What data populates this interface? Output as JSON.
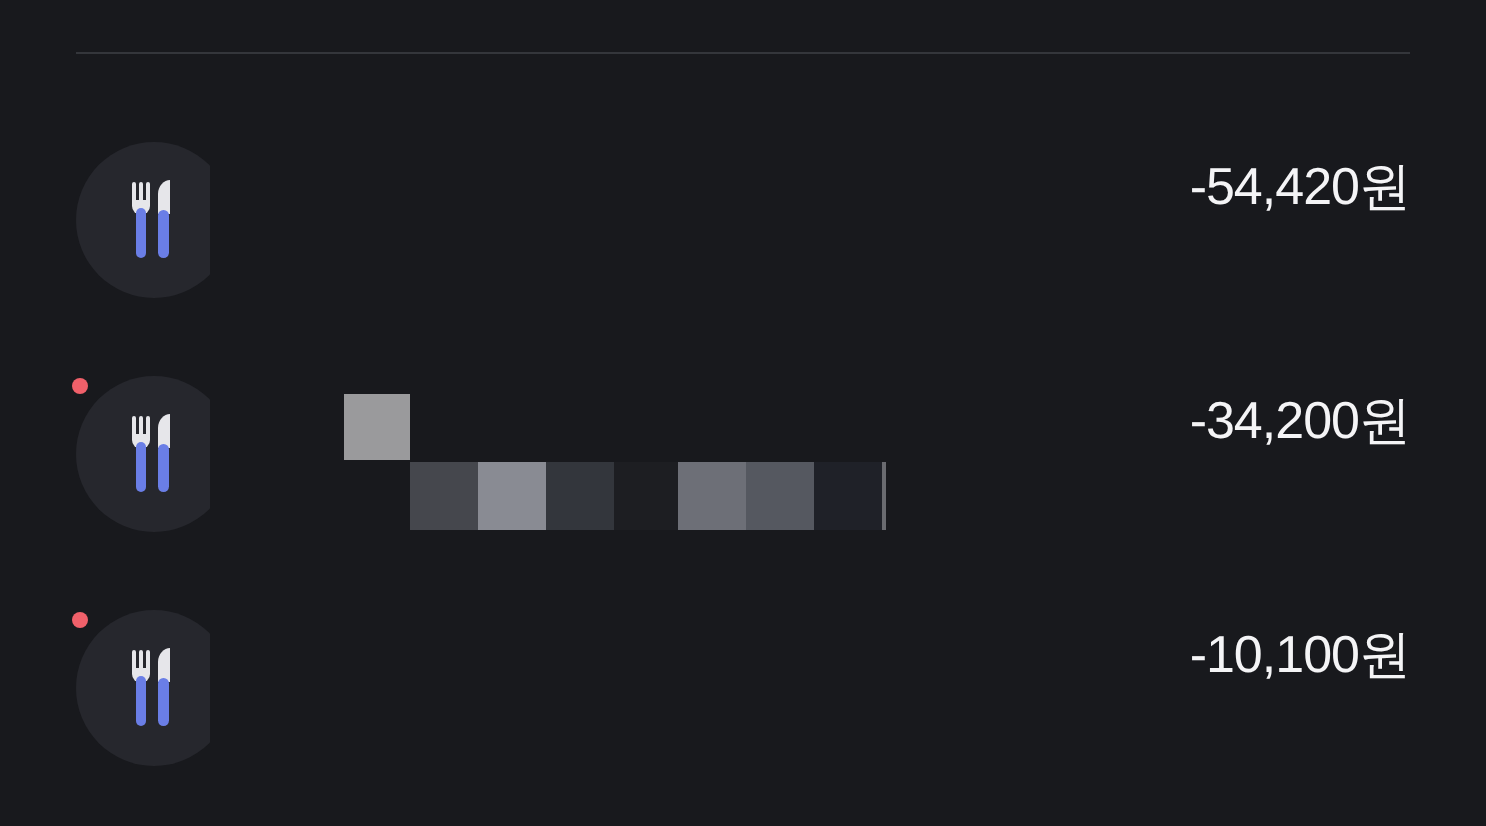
{
  "transactions": [
    {
      "unread": false,
      "redacted": false,
      "amount": "-54,420원"
    },
    {
      "unread": true,
      "redacted": true,
      "amount": "-34,200원"
    },
    {
      "unread": true,
      "redacted": false,
      "amount": "-10,100원"
    }
  ]
}
